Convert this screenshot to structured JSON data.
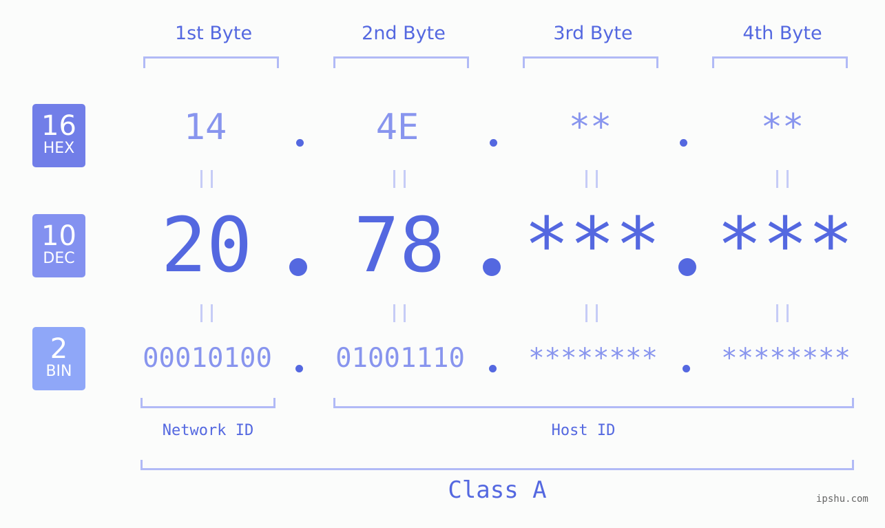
{
  "headers": [
    "1st Byte",
    "2nd Byte",
    "3rd Byte",
    "4th Byte"
  ],
  "badges": [
    {
      "number": "16",
      "label": "HEX",
      "color": "#717ee8"
    },
    {
      "number": "10",
      "label": "DEC",
      "color": "#8391f0"
    },
    {
      "number": "2",
      "label": "BIN",
      "color": "#8fa7f8"
    }
  ],
  "hex": [
    "14",
    "4E",
    "**",
    "**"
  ],
  "dec": [
    "20",
    "78",
    "***",
    "***"
  ],
  "bin": [
    "00010100",
    "01001110",
    "********",
    "********"
  ],
  "labels": {
    "network": "Network ID",
    "host": "Host ID",
    "class": "Class A"
  },
  "watermark": "ipshu.com",
  "colors": {
    "accent": "#5468e0",
    "light": "#8895ee",
    "bracket": "#b1baf6"
  }
}
